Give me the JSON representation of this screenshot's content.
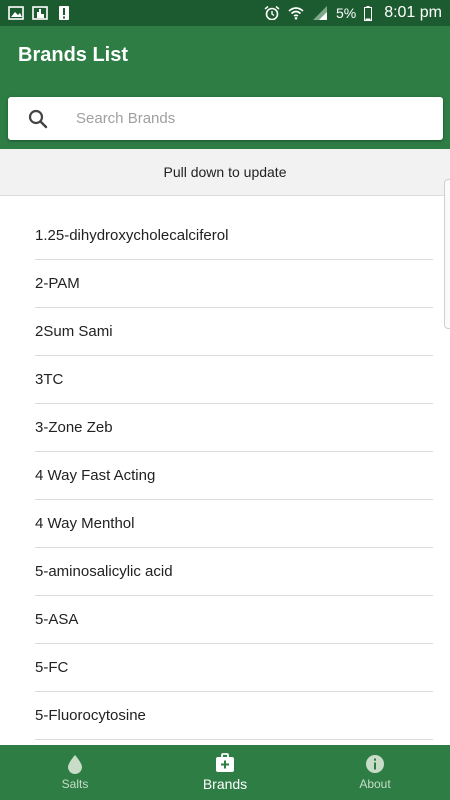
{
  "status_bar": {
    "battery": "5%",
    "time": "8:01 pm"
  },
  "app_bar": {
    "title": "Brands List",
    "search_placeholder": "Search Brands"
  },
  "pull_banner": "Pull down to update",
  "brands": [
    "1.25-dihydroxycholecalciferol",
    "2-PAM",
    "2Sum Sami",
    "3TC",
    "3-Zone Zeb",
    "4 Way Fast Acting",
    "4 Way Menthol",
    "5-aminosalicylic acid",
    "5-ASA",
    "5-FC",
    "5-Fluorocytosine"
  ],
  "bottom_nav": {
    "items": [
      {
        "label": "Salts",
        "icon": "drop-icon"
      },
      {
        "label": "Brands",
        "icon": "medical-kit-icon"
      },
      {
        "label": "About",
        "icon": "info-icon"
      }
    ],
    "active_index": 1
  },
  "colors": {
    "primary": "#2e7d45",
    "status_bar": "#1c5a30"
  }
}
